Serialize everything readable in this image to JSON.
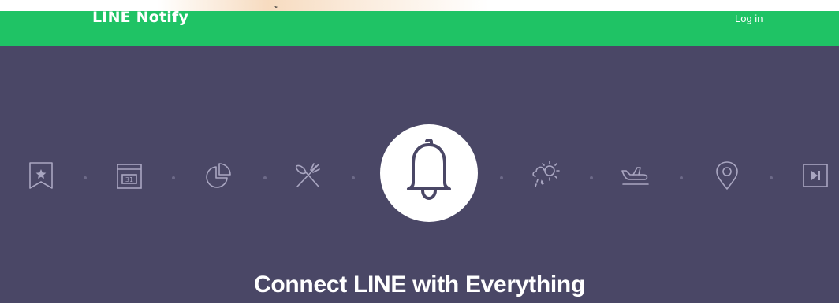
{
  "top_strip": {
    "fragment": "ู"
  },
  "header": {
    "brand": "LINE Notify",
    "login_label": "Log in"
  },
  "hero": {
    "icons": [
      "bookmark-star-icon",
      "calendar-icon",
      "pie-chart-icon",
      "utensils-icon",
      "bell-icon",
      "weather-icon",
      "airplane-icon",
      "location-pin-icon",
      "play-icon"
    ],
    "calendar_day": "31",
    "headline": "Connect LINE with Everything"
  },
  "colors": {
    "header_green": "#1fc365",
    "hero_background": "#4a4766",
    "icon_stroke": "#a9a6c1"
  }
}
